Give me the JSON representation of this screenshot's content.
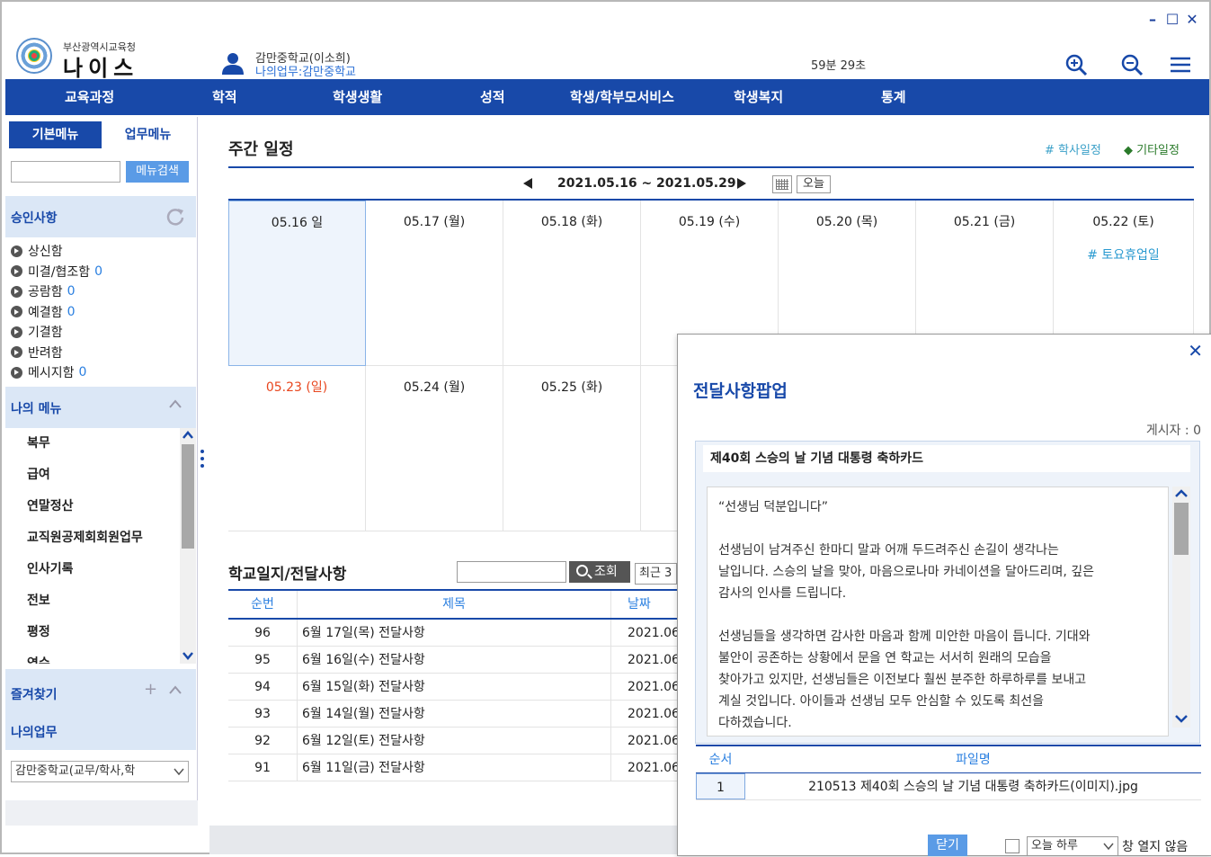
{
  "window": {
    "minimize": "–",
    "maximize": "☐",
    "close": "✕"
  },
  "header": {
    "org_sub": "부산광역시교육청",
    "org_main": "나이스",
    "user_name": "감만중학교(이소희)",
    "user_dept": "나의업무:감만중학교",
    "timer": "59분 29초"
  },
  "nav": {
    "items": [
      "교육과정",
      "학적",
      "학생생활",
      "성적",
      "학생/학부모서비스",
      "학생복지",
      "통계"
    ]
  },
  "sidebar": {
    "tabs": [
      "기본메뉴",
      "업무메뉴"
    ],
    "search_button": "메뉴검색",
    "approval_title": "승인사항",
    "approval_items": [
      {
        "label": "상신함",
        "count": ""
      },
      {
        "label": "미결/협조함",
        "count": "0"
      },
      {
        "label": "공람함",
        "count": "0"
      },
      {
        "label": "예결함",
        "count": "0"
      },
      {
        "label": "기결함",
        "count": ""
      },
      {
        "label": "반려함",
        "count": ""
      },
      {
        "label": "메시지함",
        "count": "0"
      }
    ],
    "my_menu_title": "나의 메뉴",
    "my_menu_items": [
      "복무",
      "급여",
      "연말정산",
      "교직원공제회회원업무",
      "인사기록",
      "전보",
      "평정",
      "연수"
    ],
    "favorites_title": "즐겨찾기",
    "my_work_title": "나의업무",
    "school_select": "감만중학교(교무/학사,학"
  },
  "weekly": {
    "title": "주간 일정",
    "legend_school": "# 학사일정",
    "legend_other": "◆ 기타일정",
    "range": "2021.05.16 ~ 2021.05.29",
    "today_button": "오늘",
    "week1": [
      "05.16 일",
      "05.17 (월)",
      "05.18 (화)",
      "05.19 (수)",
      "05.20 (목)",
      "05.21 (금)",
      "05.22 (토)"
    ],
    "week2": [
      "05.23 (일)",
      "05.24 (월)",
      "05.25 (화)"
    ],
    "event_sat": "# 토요휴업일"
  },
  "log": {
    "title": "학교일지/전달사항",
    "search_button": "조회",
    "period": "최근 3",
    "headers": [
      "순번",
      "제목",
      "날짜"
    ],
    "rows": [
      {
        "no": "96",
        "title": "6월 17일(목) 전달사항",
        "date": "2021.06"
      },
      {
        "no": "95",
        "title": "6월 16일(수) 전달사항",
        "date": "2021.06"
      },
      {
        "no": "94",
        "title": "6월 15일(화) 전달사항",
        "date": "2021.06"
      },
      {
        "no": "93",
        "title": "6월 14일(월) 전달사항",
        "date": "2021.06"
      },
      {
        "no": "92",
        "title": "6월 12일(토) 전달사항",
        "date": "2021.06"
      },
      {
        "no": "91",
        "title": "6월 11일(금) 전달사항",
        "date": "2021.06"
      }
    ]
  },
  "popup": {
    "title": "전달사항팝업",
    "poster": "게시자 :  0",
    "subject": "제40회 스승의 날 기념 대통령 축하카드",
    "body": [
      "“선생님 덕분입니다”",
      "선생님이 남겨주신 한마디 말과 어깨 두드려주신 손길이 생각나는\n날입니다. 스승의 날을 맞아, 마음으로나마 카네이션을 달아드리며, 깊은\n감사의 인사를 드립니다.",
      "선생님들을 생각하면 감사한 마음과 함께 미안한 마음이 듭니다. 기대와\n불안이 공존하는 상황에서 문을 연 학교는 서서히 원래의 모습을\n찾아가고 있지만, 선생님들은 이전보다 훨씬 분주한 하루하루를 보내고\n계실 것입니다. 아이들과 선생님 모두 안심할 수 있도록 최선을\n다하겠습니다."
    ],
    "file_headers": [
      "순서",
      "파일명"
    ],
    "files": [
      {
        "no": "1",
        "name": "210513 제40회 스승의 날 기념 대통령 축하카드(이미지).jpg"
      }
    ],
    "close_button": "닫기",
    "day_option": "오늘 하루",
    "no_open": "창 열지 않음"
  }
}
